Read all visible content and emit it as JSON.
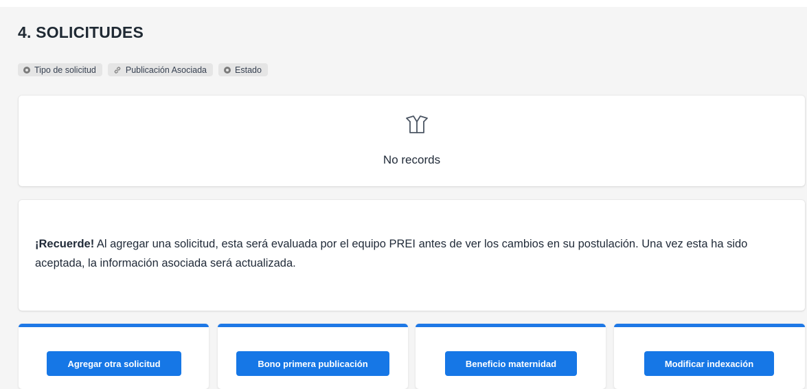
{
  "section": {
    "title": "4. SOLICITUDES"
  },
  "fields": [
    {
      "label": "Tipo de solicitud",
      "icon": "radio-icon"
    },
    {
      "label": "Publicación Asociada",
      "icon": "link-icon"
    },
    {
      "label": "Estado",
      "icon": "radio-icon"
    }
  ],
  "records": {
    "empty_icon": "empty-box-icon",
    "empty_text": "No records"
  },
  "notice": {
    "lead": "¡Recuerde!",
    "body": " Al agregar una solicitud, esta será evaluada por el equipo PREI antes de ver los cambios en su postulación. Una vez esta ha sido aceptada, la información asociada será actualizada."
  },
  "actions": [
    {
      "label": "Agregar otra solicitud"
    },
    {
      "label": "Bono primera publicación"
    },
    {
      "label": "Beneficio maternidad"
    },
    {
      "label": "Modificar indexación"
    }
  ],
  "colors": {
    "accent": "#1677e6",
    "panel_bg": "#f5f5f5",
    "chip_bg": "#e5e5e5"
  }
}
